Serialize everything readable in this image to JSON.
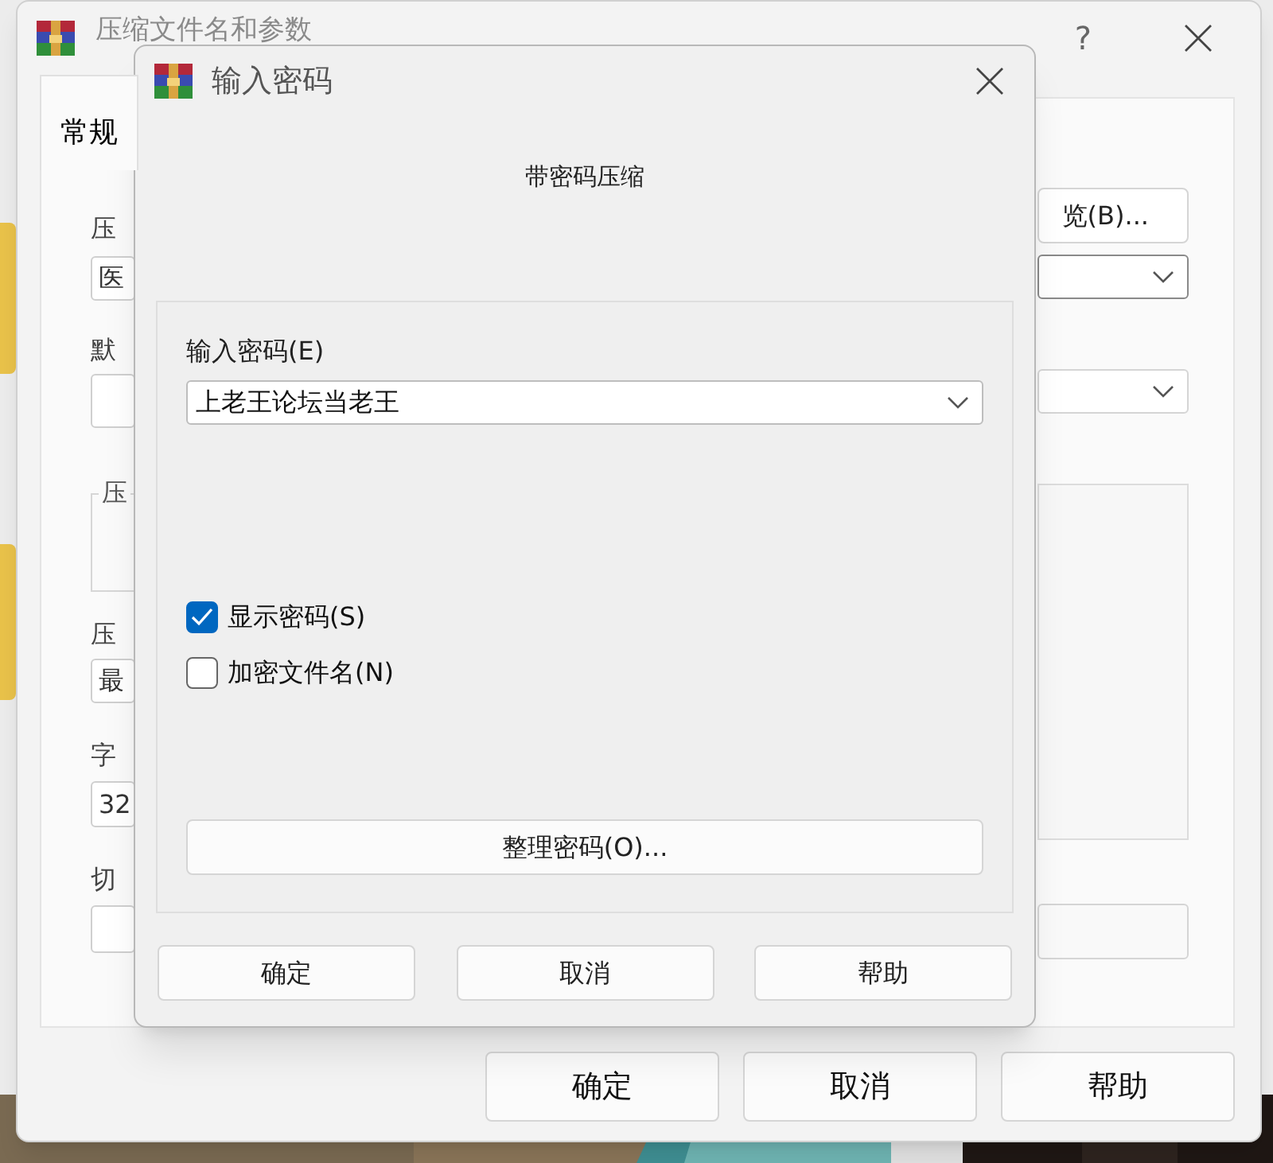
{
  "main_window": {
    "title": "压缩文件名和参数",
    "help_button": "?",
    "tabs": [
      {
        "label": "常规",
        "selected": true
      }
    ],
    "left_items": [
      {
        "kind": "field",
        "label": "压",
        "value": "医"
      },
      {
        "kind": "field",
        "label": "默"
      },
      {
        "kind": "group",
        "label": "压"
      },
      {
        "kind": "field",
        "label": "压",
        "value": "最"
      },
      {
        "kind": "field",
        "label": "字",
        "value": "32"
      },
      {
        "kind": "field",
        "label": "切"
      }
    ],
    "browse_button": "览(B)...",
    "buttons": [
      "确定",
      "取消",
      "帮助"
    ]
  },
  "password_dialog": {
    "title": "输入密码",
    "heading": "带密码压缩",
    "password_label": "输入密码(E)",
    "password_value": "上老王论坛当老王",
    "options": [
      {
        "label": "显示密码(S)",
        "checked": true
      },
      {
        "label": "加密文件名(N)",
        "checked": false
      }
    ],
    "organize_button": "整理密码(O)...",
    "buttons": [
      "确定",
      "取消",
      "帮助"
    ]
  }
}
